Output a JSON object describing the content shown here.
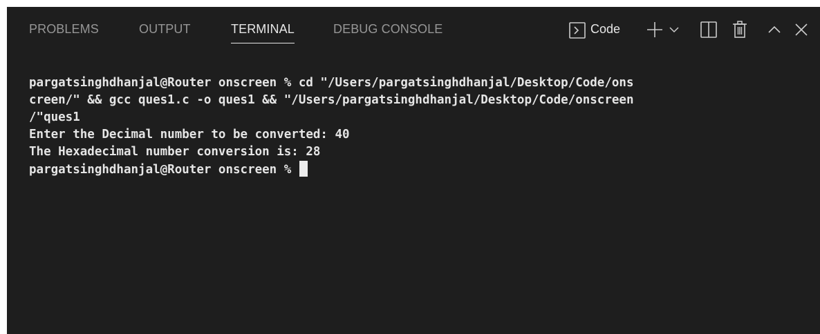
{
  "tabs": [
    {
      "label": "PROBLEMS",
      "active": false
    },
    {
      "label": "OUTPUT",
      "active": false
    },
    {
      "label": "TERMINAL",
      "active": true
    },
    {
      "label": "DEBUG CONSOLE",
      "active": false
    }
  ],
  "toolbar": {
    "terminal_name": "Code",
    "icons": [
      "terminal-icon",
      "plus-icon",
      "chevron-down-icon",
      "split-icon",
      "trash-icon",
      "chevron-up-icon",
      "close-icon"
    ]
  },
  "terminal": {
    "lines": [
      "pargatsinghdhanjal@Router onscreen % cd \"/Users/pargatsinghdhanjal/Desktop/Code/ons",
      "creen/\" && gcc ques1.c -o ques1 && \"/Users/pargatsinghdhanjal/Desktop/Code/onscreen",
      "/\"ques1",
      "Enter the Decimal number to be converted: 40",
      "The Hexadecimal number conversion is: 28"
    ],
    "prompt": "pargatsinghdhanjal@Router onscreen % "
  },
  "colors": {
    "background": "#1e1e1e",
    "tab_inactive": "#969696",
    "tab_active": "#e7e7e7",
    "text": "#e5e5e5"
  }
}
